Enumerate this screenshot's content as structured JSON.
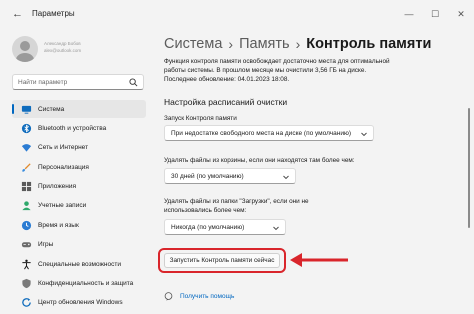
{
  "window": {
    "title": "Параметры",
    "back_icon": "back-arrow-icon",
    "controls": {
      "minimize": "—",
      "maximize": "☐",
      "close": "✕"
    }
  },
  "user": {
    "name": "Александр Бобов",
    "email": "alex@outlook.com"
  },
  "search": {
    "placeholder": "Найти параметр",
    "value": ""
  },
  "sidebar": {
    "items": [
      {
        "label": "Система",
        "icon": "monitor-icon",
        "active": true
      },
      {
        "label": "Bluetooth и устройства",
        "icon": "bluetooth-icon",
        "active": false
      },
      {
        "label": "Сеть и Интернет",
        "icon": "wifi-icon",
        "active": false
      },
      {
        "label": "Персонализация",
        "icon": "brush-icon",
        "active": false
      },
      {
        "label": "Приложения",
        "icon": "apps-icon",
        "active": false
      },
      {
        "label": "Учетные записи",
        "icon": "person-icon",
        "active": false
      },
      {
        "label": "Время и язык",
        "icon": "globe-clock-icon",
        "active": false
      },
      {
        "label": "Игры",
        "icon": "gamepad-icon",
        "active": false
      },
      {
        "label": "Специальные возможности",
        "icon": "accessibility-icon",
        "active": false
      },
      {
        "label": "Конфиденциальность и защита",
        "icon": "shield-icon",
        "active": false
      },
      {
        "label": "Центр обновления Windows",
        "icon": "refresh-icon",
        "active": false
      }
    ]
  },
  "breadcrumb": {
    "parts": [
      "Система",
      "Память"
    ],
    "separator": "›",
    "current": "Контроль памяти"
  },
  "main": {
    "description": "Функция контроля памяти освобождает достаточно места для оптимальной работы системы. В прошлом месяце мы очистили 3,56 ГБ на диске. Последнее обновление: 04.01.2023 18:08.",
    "section_title": "Настройка расписаний очистки",
    "fields": [
      {
        "label": "Запуск Контроля памяти",
        "value": "При недостатке свободного места на диске (по умолчанию)"
      },
      {
        "label": "Удалять файлы из корзины, если они находятся там более чем:",
        "value": "30 дней (по умолчанию)"
      },
      {
        "label": "Удалять файлы из папки \"Загрузки\", если они не использовались более чем:",
        "value": "Никогда (по умолчанию)"
      }
    ],
    "run_button": "Запустить Контроль памяти сейчас",
    "help_link": "Получить помощь"
  },
  "colors": {
    "accent": "#0067c0",
    "highlight": "#d9252b",
    "background": "#f3f3f3"
  }
}
